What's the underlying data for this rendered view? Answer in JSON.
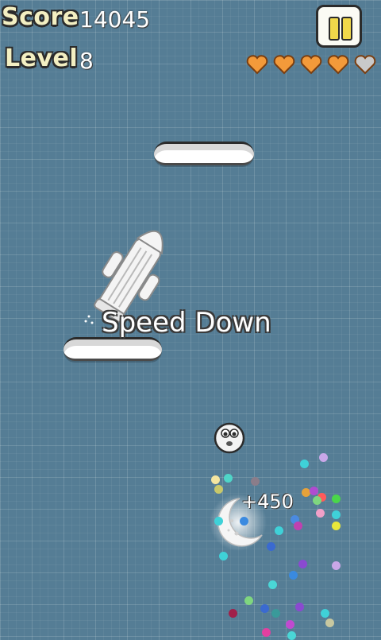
{
  "hud": {
    "score_label": "Score",
    "score_value": "14045",
    "level_label": "Level",
    "level_value": "8",
    "lives_full": 4,
    "lives_total": 5
  },
  "popups": {
    "powerup_text": "Speed Down",
    "bonus_text": "+450"
  },
  "colors": {
    "background": "#557d95",
    "heart_full": "#f39a3a",
    "heart_empty": "#c9c9c9",
    "label_text": "#f3efc2",
    "pause_bar": "#f0d84a"
  },
  "icons": {
    "pause": "pause-icon",
    "heart": "heart-icon",
    "rocket": "rocket-icon",
    "moon": "crescent-moon-icon",
    "player": "ball-character-icon"
  }
}
